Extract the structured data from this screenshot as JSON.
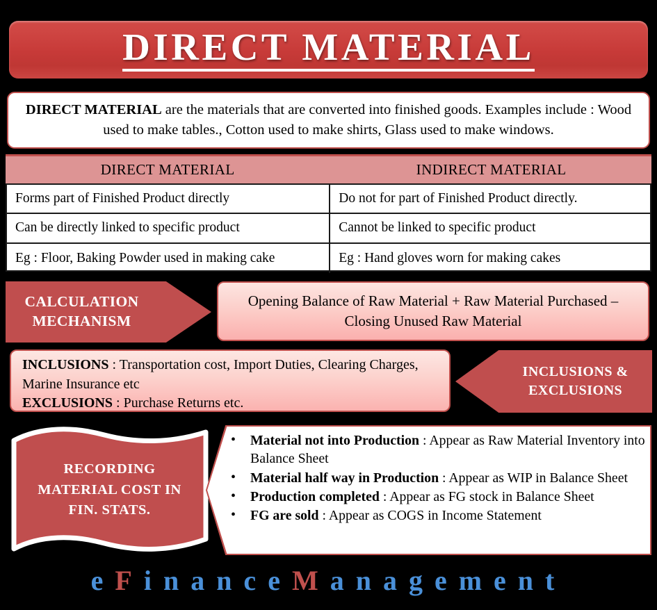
{
  "title": {
    "text": "DIRECT MATERIAL"
  },
  "description": {
    "bold_lead": "DIRECT MATERIAL",
    "body": " are the materials that are converted into finished goods. Examples include : Wood used to make tables., Cotton used to make shirts, Glass used to make windows."
  },
  "comparison_table": {
    "headers": [
      "DIRECT MATERIAL",
      "INDIRECT MATERIAL"
    ],
    "rows": [
      [
        "Forms part of Finished Product directly",
        "Do not for part of Finished Product directly."
      ],
      [
        "Can be directly linked to specific product",
        "Cannot be linked to specific product"
      ],
      [
        "Eg : Floor, Baking Powder used in making cake",
        "Eg : Hand gloves worn for making cakes"
      ]
    ]
  },
  "calculation": {
    "arrow_line1": "CALCULATION",
    "arrow_line2": "MECHANISM",
    "formula_line1": "Opening Balance of Raw Material + Raw Material Purchased –",
    "formula_line2": "Closing Unused Raw Material"
  },
  "inclusions_exclusions": {
    "arrow_line1": "INCLUSIONS &",
    "arrow_line2": "EXCLUSIONS",
    "inclusions_label": "INCLUSIONS",
    "inclusions_value": " : Transportation cost, Import Duties, Clearing Charges, Marine Insurance etc",
    "exclusions_label": "EXCLUSIONS",
    "exclusions_value": " : Purchase Returns  etc."
  },
  "recording": {
    "flag_line1": "RECORDING",
    "flag_line2": "MATERIAL COST IN",
    "flag_line3": "FIN. STATS.",
    "bullets": [
      {
        "lead": "Material not into Production",
        "rest": " : Appear as Raw Material Inventory into Balance Sheet"
      },
      {
        "lead": "Material half way in Production",
        "rest": " : Appear as WIP in Balance Sheet"
      },
      {
        "lead": "Production completed",
        "rest": " : Appear as FG stock in Balance Sheet"
      },
      {
        "lead": "FG are sold",
        "rest": " : Appear as COGS in Income Statement"
      }
    ]
  },
  "footer": {
    "part1": "e",
    "cap1": "F",
    "part2": "inance",
    "cap2": "M",
    "part3": "anagement"
  },
  "colors": {
    "title_red": "#c73a38",
    "accent_red": "#c0504d",
    "arrow_red": "#c04e4e",
    "table_header_pink": "#dd9494",
    "gradient_top": "#fde5e1",
    "gradient_bottom": "#fbb0ae",
    "logo_blue": "#4a90d9",
    "background": "#000000"
  }
}
